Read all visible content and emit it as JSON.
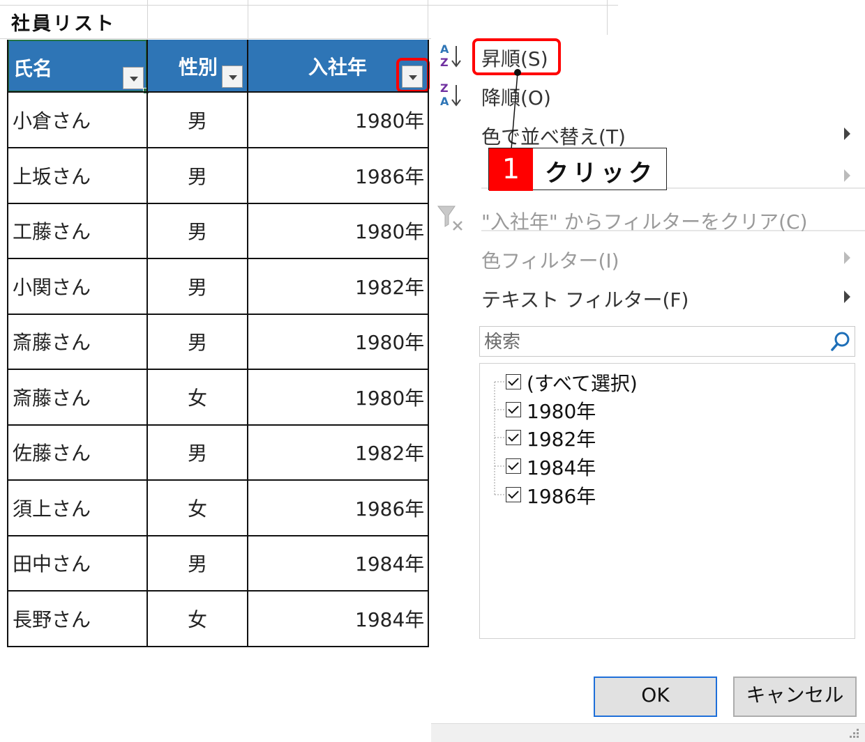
{
  "sheet": {
    "title": "社員リスト",
    "headers": [
      "氏名",
      "性別",
      "入社年"
    ],
    "rows": [
      {
        "name": "小倉さん",
        "gender": "男",
        "year": "1980年"
      },
      {
        "name": "上坂さん",
        "gender": "男",
        "year": "1986年"
      },
      {
        "name": "工藤さん",
        "gender": "男",
        "year": "1980年"
      },
      {
        "name": "小関さん",
        "gender": "男",
        "year": "1982年"
      },
      {
        "name": "斎藤さん",
        "gender": "男",
        "year": "1980年"
      },
      {
        "name": "斎藤さん",
        "gender": "女",
        "year": "1980年"
      },
      {
        "name": "佐藤さん",
        "gender": "男",
        "year": "1982年"
      },
      {
        "name": "須上さん",
        "gender": "女",
        "year": "1986年"
      },
      {
        "name": "田中さん",
        "gender": "男",
        "year": "1984年"
      },
      {
        "name": "長野さん",
        "gender": "女",
        "year": "1984年"
      }
    ],
    "header_color": "#2e75b6"
  },
  "filter_menu": {
    "sort_asc": "昇順(S)",
    "sort_desc": "降順(O)",
    "sort_by_color": "色で並べ替え(T)",
    "clear_filter": "\"入社年\" からフィルターをクリア(C)",
    "color_filter": "色フィルター(I)",
    "text_filter": "テキスト フィルター(F)",
    "search_placeholder": "検索",
    "items": [
      "(すべて選択)",
      "1980年",
      "1982年",
      "1984年",
      "1986年"
    ],
    "ok": "OK",
    "cancel": "キャンセル"
  },
  "annotation": {
    "step": "1",
    "label": "クリック",
    "highlight_color": "#ff0000"
  },
  "icons": {
    "sort_asc": "sort-ascending-icon",
    "sort_desc": "sort-descending-icon",
    "clear_filter": "clear-filter-icon",
    "search": "search-icon"
  }
}
